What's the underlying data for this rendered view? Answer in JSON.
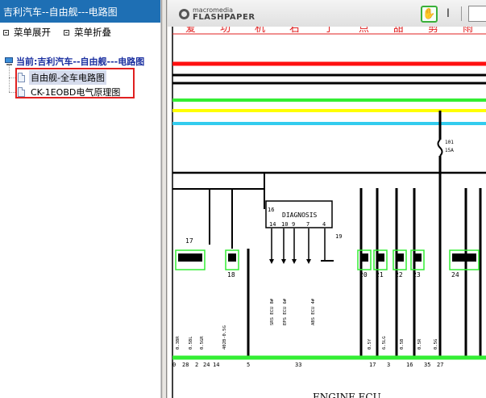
{
  "left_panel": {
    "title": "吉利汽车--自由舰---电路图",
    "expand_label": "菜单展开",
    "collapse_label": "菜单折叠",
    "tree_root": "当前:吉利汽车--自由舰---电路图",
    "items": [
      {
        "label": "自由舰-全车电路图",
        "selected": true
      },
      {
        "label": "CK-1EOBD电气原理图",
        "selected": false
      }
    ],
    "highlight_color": "#e02020"
  },
  "viewer": {
    "logo_top": "macromedia",
    "logo_bottom": "FLASHPAPER",
    "hand_tool_icon": "hand-icon",
    "text_tool_icon": "text-cursor-icon"
  },
  "diagram": {
    "header_chars": [
      "爱",
      "功",
      "机",
      "右",
      "了",
      "点",
      "甜",
      "剪",
      "雨"
    ],
    "fuse_label": "101",
    "fuse_rating": "15A",
    "diagnosis_title": "DIAGNOSIS",
    "diag_top_pin": "16",
    "diag_pins": [
      "14",
      "10",
      "9",
      "7",
      "4"
    ],
    "diag_side_pin": "19",
    "connector_numbers": [
      "17",
      "18",
      "20",
      "21",
      "22",
      "23",
      "24"
    ],
    "wire_labels_left": [
      "0.3BR",
      "0.5BL",
      "0.5GR",
      "402B-0.5G"
    ],
    "wire_labels_mid": [
      "SRS ECU 8#",
      "EPS ECU 6#",
      "ABS ECU 4#"
    ],
    "wire_labels_right": [
      "0.5Y",
      "6.5LG",
      "0.5B",
      "0.5R",
      "0.5G"
    ],
    "bottom_pins": [
      "0",
      "28",
      "2",
      "24",
      "14",
      "5",
      "33",
      "17",
      "3",
      "16",
      "35",
      "27"
    ],
    "bottom_title": "ENGINE ECU",
    "colors": {
      "red": "#ff1010",
      "green": "#33ee33",
      "yellow": "#ffff00",
      "cyan": "#33ccee",
      "black": "#000000"
    }
  }
}
